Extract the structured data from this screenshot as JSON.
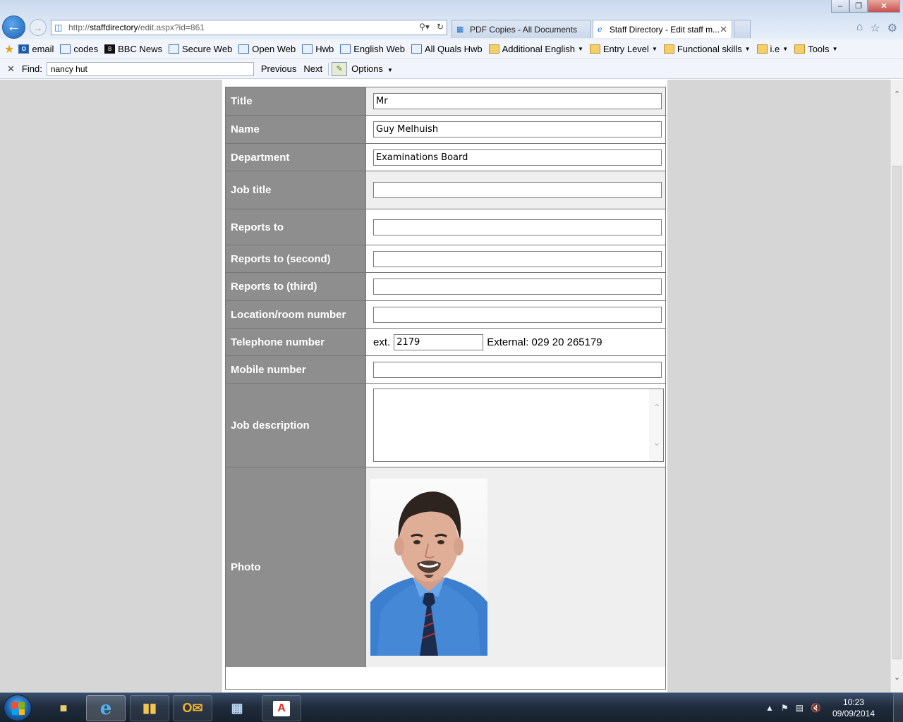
{
  "browser": {
    "url_prefix": "http://",
    "url_domain": "staffdirectory",
    "url_path": "/edit.aspx?id=861",
    "tabs": [
      {
        "label": "PDF Copies - All Documents"
      },
      {
        "label": "Staff Directory - Edit staff m..."
      }
    ],
    "favorites": [
      {
        "label": "email",
        "icon": "outlook-icon"
      },
      {
        "label": "codes",
        "icon": "web-slice-icon"
      },
      {
        "label": "BBC News",
        "icon": "bbc-icon"
      },
      {
        "label": "Secure Web",
        "icon": "web-slice-icon"
      },
      {
        "label": "Open Web",
        "icon": "web-slice-icon"
      },
      {
        "label": "Hwb",
        "icon": "page-icon"
      },
      {
        "label": "English Web",
        "icon": "web-slice-icon"
      },
      {
        "label": "All Quals Hwb",
        "icon": "web-slice-icon"
      },
      {
        "label": "Additional English",
        "icon": "folder-icon",
        "dropdown": true
      },
      {
        "label": "Entry Level",
        "icon": "folder-icon",
        "dropdown": true
      },
      {
        "label": "Functional skills",
        "icon": "folder-icon",
        "dropdown": true
      },
      {
        "label": "i.e",
        "icon": "folder-icon",
        "dropdown": true
      },
      {
        "label": "Tools",
        "icon": "folder-icon",
        "dropdown": true
      }
    ],
    "find": {
      "label": "Find:",
      "value": "nancy hut",
      "previous": "Previous",
      "next": "Next",
      "options": "Options"
    }
  },
  "form": {
    "title_label": "Title",
    "title_value": "Mr",
    "name_label": "Name",
    "name_value": "Guy Melhuish",
    "department_label": "Department",
    "department_value": "Examinations Board",
    "job_title_label": "Job title",
    "job_title_value": "",
    "reports_to_label": "Reports to",
    "reports_to_value": "",
    "reports_to_second_label": "Reports to (second)",
    "reports_to_second_value": "",
    "reports_to_third_label": "Reports to (third)",
    "reports_to_third_value": "",
    "location_label": "Location/room number",
    "location_value": "",
    "telephone_label": "Telephone number",
    "telephone_ext_prefix": "ext.",
    "telephone_ext_value": "2179",
    "telephone_external": "External: 029 20 265179",
    "mobile_label": "Mobile number",
    "mobile_value": "",
    "job_description_label": "Job description",
    "job_description_value": "",
    "photo_label": "Photo"
  },
  "taskbar": {
    "time": "10:23",
    "date": "09/09/2014",
    "apps": [
      "windows-explorer-libraries",
      "internet-explorer",
      "file-explorer",
      "outlook",
      "calculator",
      "adobe-reader"
    ]
  },
  "colors": {
    "label_bg": "#8e8e8e",
    "page_bg": "#d6d6d6",
    "accent_blue": "#1c63b7"
  }
}
